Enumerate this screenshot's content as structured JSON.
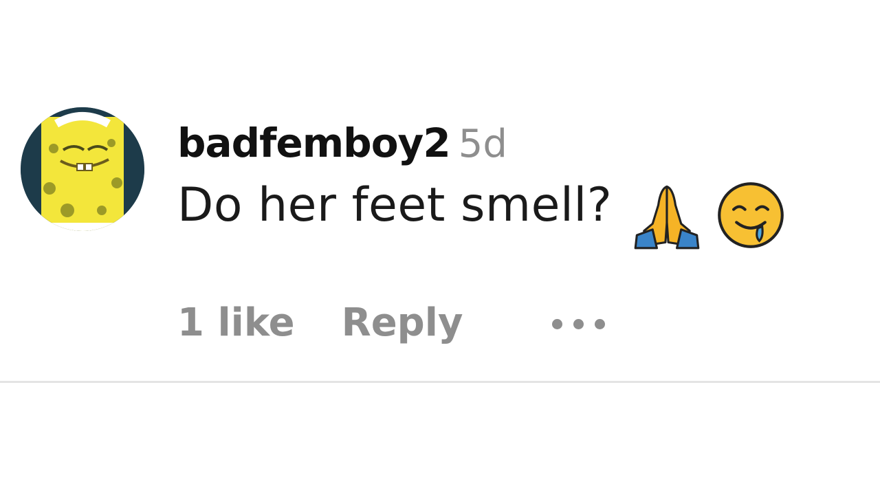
{
  "comment": {
    "username": "badfemboy2",
    "timestamp": "5d",
    "text": "Do her feet smell?",
    "emojis": [
      "folded-hands-emoji",
      "drooling-face-emoji"
    ],
    "likes_label": "1 like",
    "reply_label": "Reply",
    "more_icon": "more-options-icon"
  },
  "colors": {
    "username": "#111111",
    "meta": "#8e8e8e",
    "divider": "#e4e4e4"
  }
}
